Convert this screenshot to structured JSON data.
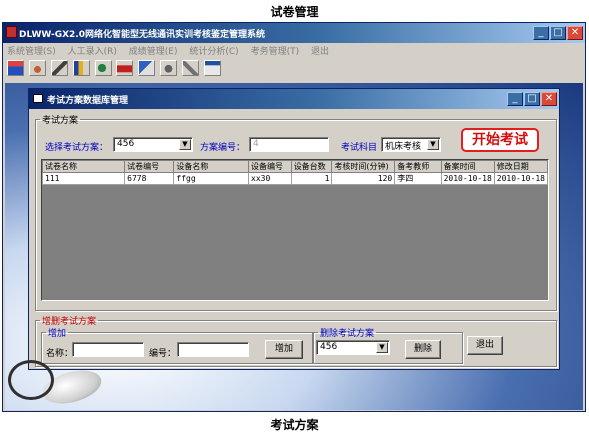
{
  "captions": {
    "top": "试卷管理",
    "bottom": "考试方案"
  },
  "outer_window": {
    "title": "DLWW-GX2.0网络化智能型无线通讯实训考核鉴定管理系统",
    "menu": [
      "系统管理(S)",
      "人工录入(R)",
      "成绩管理(E)",
      "统计分析(C)",
      "考务管理(T)",
      "退出"
    ],
    "controls": {
      "minimize": "_",
      "maximize": "□",
      "close": "✕"
    }
  },
  "toolbar_icons": [
    "tool-1-icon",
    "tool-2-icon",
    "tool-3-icon",
    "tool-4-icon",
    "tool-5-icon",
    "tool-6-icon",
    "tool-7-icon",
    "tool-8-icon",
    "tool-9-icon",
    "tool-10-icon"
  ],
  "inner_window": {
    "title": "考试方案数据库管理",
    "controls": {
      "minimize": "_",
      "maximize": "□",
      "close": "✕"
    },
    "exam_group": {
      "legend": "考试方案",
      "select_plan_label": "选择考试方案：",
      "select_plan_value": "456",
      "plan_no_label": "方案编号：",
      "plan_no_value": "4",
      "subject_label": "考试科目",
      "subject_value": "机床考核",
      "start_button": "开始考试"
    },
    "grid": {
      "columns": [
        "试卷名称",
        "试卷编号",
        "设备名称",
        "设备编号",
        "设备台数",
        "考核时间(分钟)",
        "备考教师",
        "备案时间",
        "修改日期"
      ],
      "rows": [
        [
          "111",
          "6778",
          "ffgg",
          "xx30",
          "1",
          "120",
          "李四",
          "2010-10-18",
          "2010-10-18"
        ]
      ]
    },
    "manage_group": {
      "legend": "增删考试方案",
      "add_legend": "增加",
      "name_label": "名称：",
      "name_value": "",
      "number_label": "编号：",
      "number_value": "",
      "add_button": "增加",
      "delete_legend": "删除考试方案",
      "delete_value": "456",
      "delete_button": "删除",
      "exit_button": "退出"
    }
  },
  "colors": {
    "title_start": "#0a246a",
    "title_end": "#a6caf0",
    "face": "#d4d0c8",
    "accent_red": "#d01010",
    "label_blue": "#0000c0"
  }
}
